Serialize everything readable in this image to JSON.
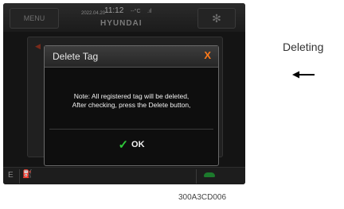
{
  "topbar": {
    "menu_label": "MENU",
    "date": "2022.04.20",
    "time": "11:12",
    "temperature": "--°C",
    "signal": ".ıl",
    "brand": "HYUNDAI",
    "fan_icon": "fan-icon"
  },
  "bottombar": {
    "e_label": "E",
    "fuel_icon": "fuel-icon",
    "car_icon": "car-icon"
  },
  "dialog": {
    "title": "Delete Tag",
    "close_symbol": "X",
    "message_line1": "Note: All registered tag will be deleted,",
    "message_line2": "After checking, press the Delete button,",
    "ok_label": "OK",
    "check_symbol": "✓"
  },
  "annotation": {
    "label": "Deleting",
    "arrow_icon": "arrow-left-icon"
  },
  "caption": "300A3CD006",
  "colors": {
    "close_x": "#ff7a1a",
    "check": "#2ec93a",
    "screen_bg": "#141414"
  }
}
